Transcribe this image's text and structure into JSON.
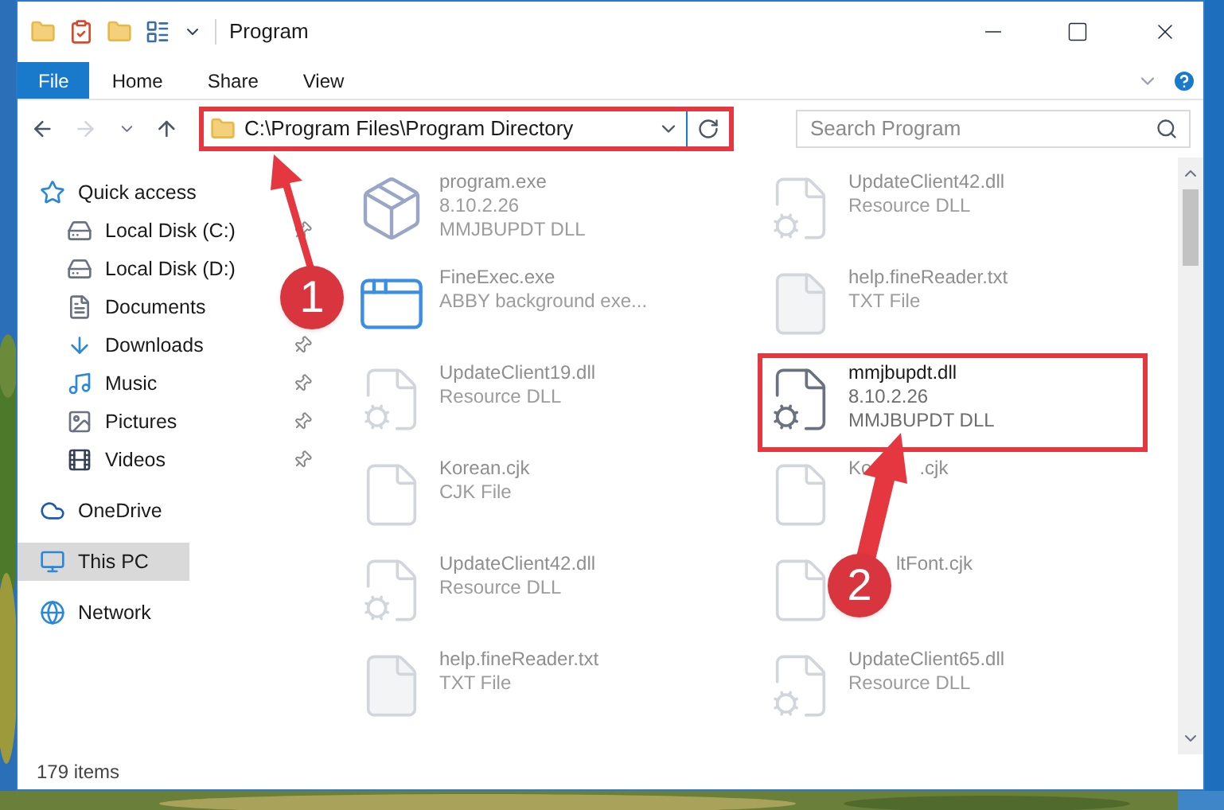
{
  "window": {
    "title": "Program"
  },
  "ribbon_tabs": [
    {
      "label": "File",
      "kind": "file"
    },
    {
      "label": "Home",
      "kind": "tab"
    },
    {
      "label": "Share",
      "kind": "tab"
    },
    {
      "label": "View",
      "kind": "tab"
    }
  ],
  "address": {
    "path": "C:\\Program Files\\Program Directory"
  },
  "search": {
    "placeholder": "Search Program"
  },
  "sidebar": {
    "items": [
      {
        "label": "Quick access",
        "kind": "quick",
        "selected": false,
        "children": [
          {
            "label": "Local Disk (C:)",
            "kind": "disk-c",
            "pinned": true,
            "selected": false
          },
          {
            "label": "Local Disk (D:)",
            "kind": "disk",
            "pinned": false,
            "selected": false
          },
          {
            "label": "Documents",
            "kind": "documents",
            "pinned": false,
            "selected": false
          },
          {
            "label": "Downloads",
            "kind": "downloads",
            "pinned": true,
            "selected": false
          },
          {
            "label": "Music",
            "kind": "music",
            "pinned": true,
            "selected": false
          },
          {
            "label": "Pictures",
            "kind": "pictures",
            "pinned": true,
            "selected": false
          },
          {
            "label": "Videos",
            "kind": "videos",
            "pinned": true,
            "selected": false
          }
        ]
      },
      {
        "label": "OneDrive",
        "kind": "onedrive",
        "selected": false
      },
      {
        "label": "This PC",
        "kind": "pc",
        "selected": true
      },
      {
        "label": "Network",
        "kind": "network",
        "selected": false
      }
    ]
  },
  "files": [
    {
      "name": "program.exe",
      "details": [
        "8.10.2.26",
        "MMJBUPDT DLL"
      ],
      "kind": "setup",
      "selected": false
    },
    {
      "name": "UpdateClient42.dll",
      "details": [
        "Resource DLL"
      ],
      "kind": "dll",
      "selected": false
    },
    {
      "name": "FineExec.exe",
      "details": [
        "ABBY background exe..."
      ],
      "kind": "app",
      "selected": false
    },
    {
      "name": "help.fineReader.txt",
      "details": [
        "TXT File"
      ],
      "kind": "txt",
      "selected": false
    },
    {
      "name": "UpdateClient19.dll",
      "details": [
        "Resource DLL"
      ],
      "kind": "dll",
      "selected": false
    },
    {
      "name": "mmjbupdt.dll",
      "details": [
        "8.10.2.26",
        "MMJBUPDT DLL"
      ],
      "kind": "dll",
      "selected": true
    },
    {
      "name": "Korean.cjk",
      "details": [
        "CJK File"
      ],
      "kind": "blank",
      "selected": false
    },
    {
      "name": "Ko",
      "name_after": ".cjk",
      "kind": "blank",
      "selected": false
    },
    {
      "name": "UpdateClient42.dll",
      "details": [
        "Resource DLL"
      ],
      "kind": "dll",
      "selected": false
    },
    {
      "name_after": "ltFont.cjk",
      "kind": "blank",
      "selected": false
    },
    {
      "name": "help.fineReader.txt",
      "details": [
        "TXT File"
      ],
      "kind": "txt",
      "selected": false
    },
    {
      "name": "UpdateClient65.dll",
      "details": [
        "Resource DLL"
      ],
      "kind": "dll",
      "selected": false
    }
  ],
  "status_bar": {
    "count": "179 items"
  },
  "annotations": [
    {
      "number": "1"
    },
    {
      "number": "2"
    }
  ]
}
